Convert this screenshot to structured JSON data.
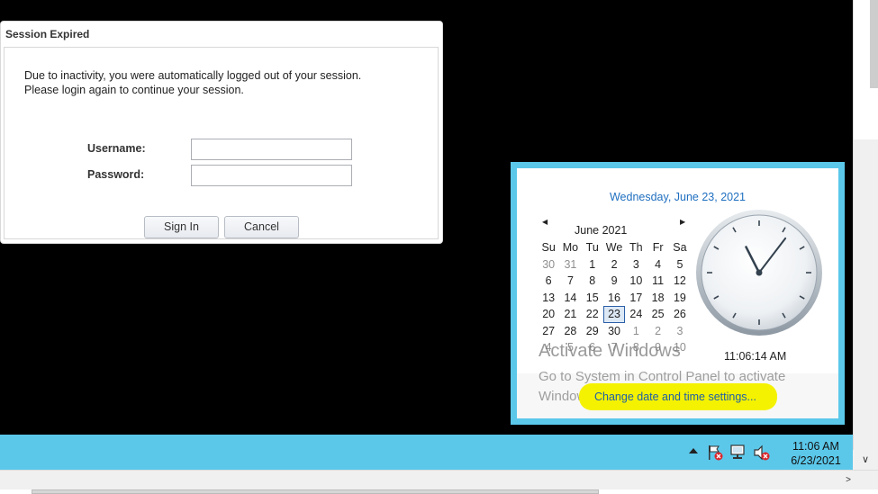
{
  "dialog": {
    "title": "Session Expired",
    "message_line1": "Due to inactivity, you were automatically logged out of your session.",
    "message_line2": "Please login again to continue your session.",
    "username_label": "Username:",
    "password_label": "Password:",
    "username_value": "",
    "password_value": "",
    "sign_in_label": "Sign In",
    "cancel_label": "Cancel"
  },
  "flyout": {
    "long_date": "Wednesday, June 23, 2021",
    "month_title": "June 2021",
    "prev_glyph": "◀",
    "next_glyph": "▶",
    "weekdays": [
      "Su",
      "Mo",
      "Tu",
      "We",
      "Th",
      "Fr",
      "Sa"
    ],
    "weeks": [
      [
        {
          "d": "30",
          "o": true
        },
        {
          "d": "31",
          "o": true
        },
        {
          "d": "1"
        },
        {
          "d": "2"
        },
        {
          "d": "3"
        },
        {
          "d": "4"
        },
        {
          "d": "5"
        }
      ],
      [
        {
          "d": "6"
        },
        {
          "d": "7"
        },
        {
          "d": "8"
        },
        {
          "d": "9"
        },
        {
          "d": "10"
        },
        {
          "d": "11"
        },
        {
          "d": "12"
        }
      ],
      [
        {
          "d": "13"
        },
        {
          "d": "14"
        },
        {
          "d": "15"
        },
        {
          "d": "16"
        },
        {
          "d": "17"
        },
        {
          "d": "18"
        },
        {
          "d": "19"
        }
      ],
      [
        {
          "d": "20"
        },
        {
          "d": "21"
        },
        {
          "d": "22"
        },
        {
          "d": "23",
          "today": true
        },
        {
          "d": "24"
        },
        {
          "d": "25"
        },
        {
          "d": "26"
        }
      ],
      [
        {
          "d": "27"
        },
        {
          "d": "28"
        },
        {
          "d": "29"
        },
        {
          "d": "30"
        },
        {
          "d": "1",
          "o": true
        },
        {
          "d": "2",
          "o": true
        },
        {
          "d": "3",
          "o": true
        }
      ],
      [
        {
          "d": "4",
          "o": true
        },
        {
          "d": "5",
          "o": true
        },
        {
          "d": "6",
          "o": true
        },
        {
          "d": "7",
          "o": true
        },
        {
          "d": "8",
          "o": true
        },
        {
          "d": "9",
          "o": true
        },
        {
          "d": "10",
          "o": true
        }
      ]
    ],
    "clock": {
      "hour": 11,
      "minute": 6,
      "second": 14
    },
    "time_text": "11:06:14 AM",
    "activate_title": "Activate Windows",
    "activate_sub": "Go to System in Control Panel to activate Windows.",
    "change_link": "Change date and time settings..."
  },
  "taskbar": {
    "time": "11:06 AM",
    "date": "6/23/2021",
    "icons": [
      "action-center-flag-icon",
      "network-icon",
      "volume-muted-icon"
    ]
  },
  "scrollbar": {
    "down_glyph": "∨",
    "right_glyph": ">"
  },
  "colors": {
    "taskbar": "#5bc8ea",
    "link": "#1f5fa8",
    "highlight": "#f4f200"
  }
}
